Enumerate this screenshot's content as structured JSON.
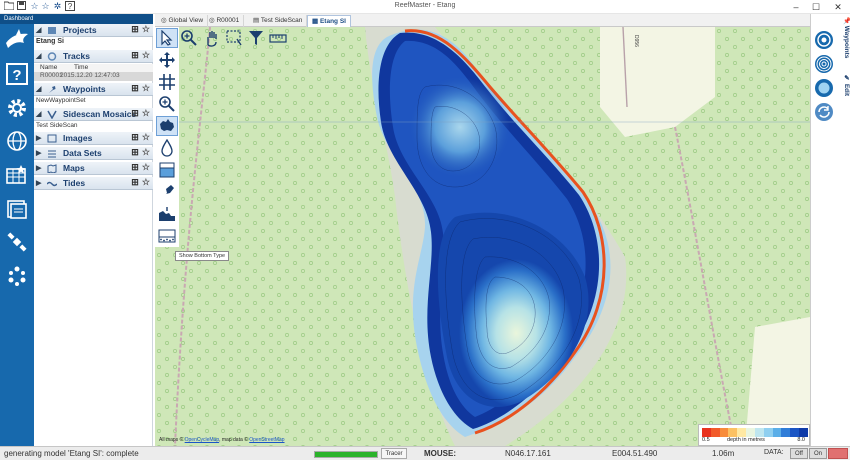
{
  "titlebar": {
    "title": "ReefMaster - Etang",
    "quick_access": [
      "folder-icon",
      "save-icon",
      "star-icon",
      "star-outline-icon",
      "gear-icon",
      "help-icon"
    ]
  },
  "rail": {
    "dashboard_label": "Dashboard",
    "icons": [
      "shark-logo",
      "help-icon",
      "settings-gear-icon",
      "globe-icon",
      "grid-map-icon",
      "folder-icon",
      "satellite-icon",
      "dots-ring-icon"
    ]
  },
  "panel": {
    "projects": {
      "label": "Projects",
      "item": "Etang Si"
    },
    "tracks": {
      "label": "Tracks",
      "col_name": "Name",
      "col_time": "Time",
      "row_name": "R00001",
      "row_time": "2015.12.20 12:47:03"
    },
    "waypoints": {
      "label": "Waypoints",
      "item": "NewWaypointSet"
    },
    "mosaics": {
      "label": "Sidescan Mosaics",
      "item": "Test SideScan"
    },
    "images": {
      "label": "Images"
    },
    "datasets": {
      "label": "Data Sets"
    },
    "maps": {
      "label": "Maps"
    },
    "tides": {
      "label": "Tides"
    }
  },
  "tabs": [
    {
      "label": "Global View",
      "active": false
    },
    {
      "label": "R00001",
      "active": false
    },
    {
      "label": "Test SideScan",
      "active": false
    },
    {
      "label": "Etang SI",
      "active": true
    }
  ],
  "tooltip": "Show Bottom Type",
  "map": {
    "attribution_prefix": "All maps ©",
    "attribution_link1": "OpenCycleMap",
    "attribution_mid": ", map data ©",
    "attribution_link2": "OpenStreetMap",
    "road_label": "D956"
  },
  "legend": {
    "min": "0.5",
    "label": "depth in metres",
    "max": "8.0",
    "colors": [
      "#e8321e",
      "#f25a2a",
      "#f88c3a",
      "#fcc162",
      "#ffe9a3",
      "#e9f5e0",
      "#bfe6ef",
      "#8fcff0",
      "#5aaee8",
      "#2f7dd8",
      "#1a55c4",
      "#0f3ba8"
    ]
  },
  "right_rail": {
    "tab_waypoints": "Waypoints",
    "tab_edit": "Edit"
  },
  "status": {
    "message": "generating model 'Etang SI': complete",
    "progress": 1.0,
    "tracer": "Tracer",
    "mouse_label": "MOUSE:",
    "lat": "N046.17.161",
    "lon": "E004.51.490",
    "depth": "1.06m",
    "data_label": "DATA:",
    "off": "Off",
    "on": "On"
  }
}
